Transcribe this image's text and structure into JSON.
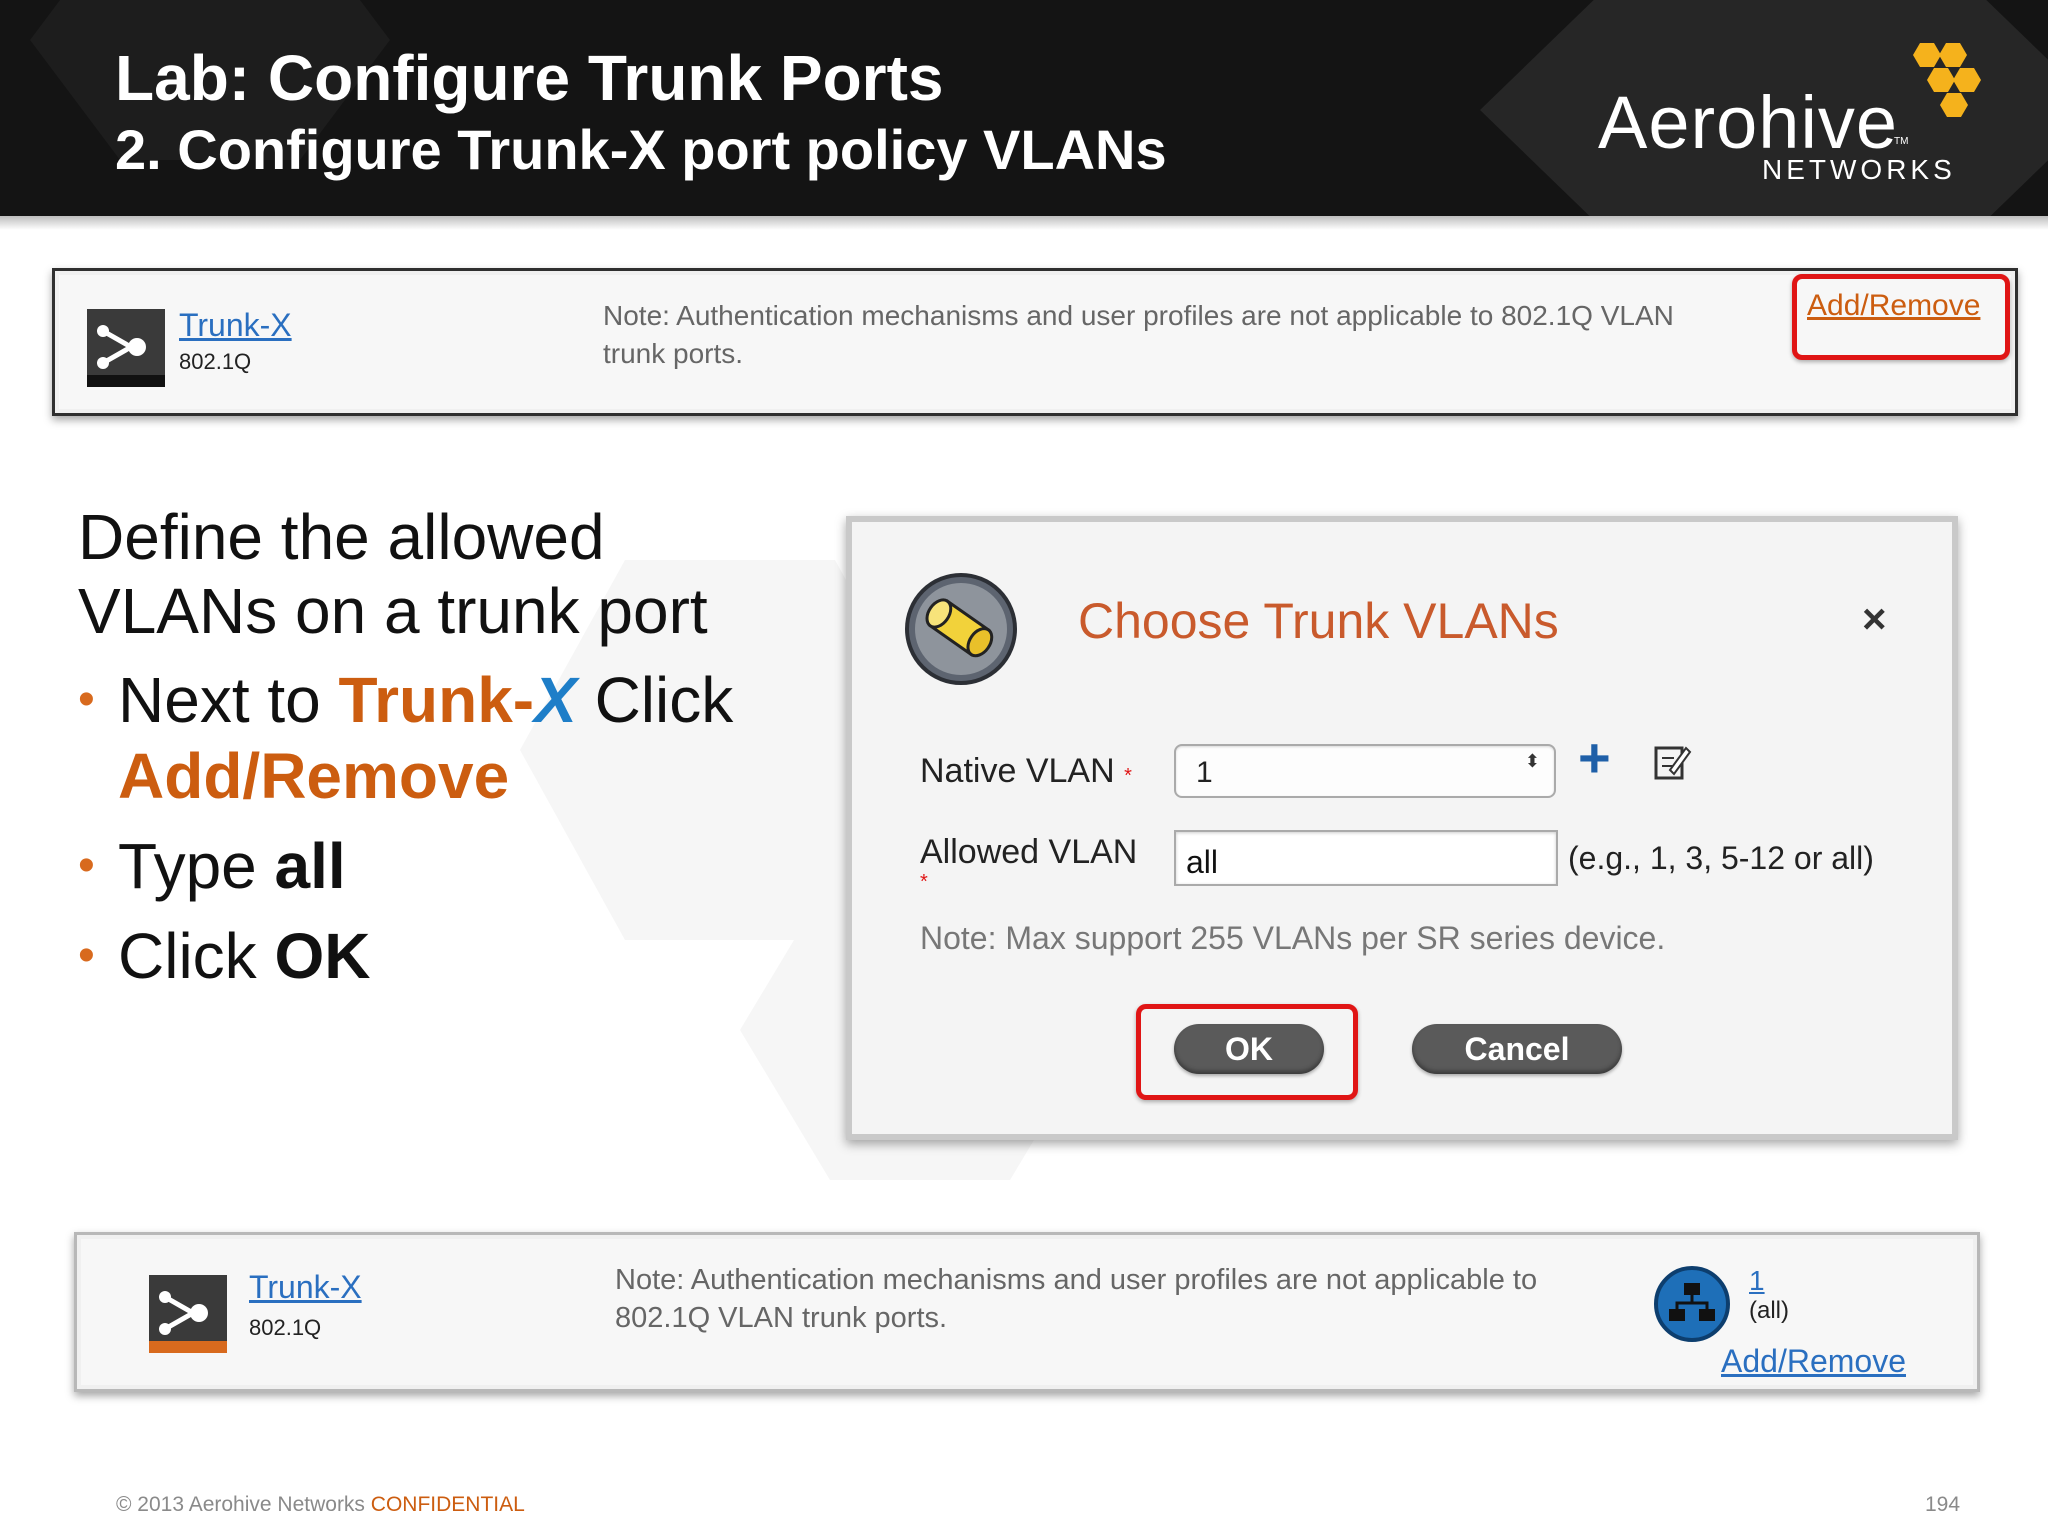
{
  "header": {
    "title": "Lab: Configure Trunk Ports",
    "subtitle": "2. Configure Trunk-X port policy VLANs",
    "logo_word": "Aerohive",
    "logo_tm": "TM",
    "logo_sub": "NETWORKS"
  },
  "top_panel": {
    "port_name": "Trunk-X",
    "port_type": "802.1Q",
    "note_line1": "Note: Authentication mechanisms and user profiles are not applicable to 802.1Q VLAN",
    "note_line2": "trunk ports.",
    "add_remove_label": "Add/Remove"
  },
  "instructions": {
    "heading_line1": "Define the allowed",
    "heading_line2": "VLANs on a trunk port",
    "bullet_dot": "•",
    "b1_pre": "Next to ",
    "b1_trunk": "Trunk-",
    "b1_x": "X",
    "b1_click": " Click",
    "b1_addremove": "Add/Remove",
    "b2_pre": "Type ",
    "b2_bold": "all",
    "b3_pre": "Click ",
    "b3_bold": "OK"
  },
  "dialog": {
    "title": "Choose Trunk VLANs",
    "close_glyph": "×",
    "native_vlan_label": "Native VLAN",
    "native_vlan_value": "1",
    "required_mark": "*",
    "allowed_vlan_label": "Allowed VLAN",
    "allowed_vlan_value": "all",
    "allowed_hint": "(e.g., 1, 3, 5-12 or all)",
    "note": "Note: Max support 255 VLANs per SR series device.",
    "ok_label": "OK",
    "cancel_label": "Cancel",
    "add_glyph": "+",
    "select_arrows": "⬍"
  },
  "bottom_panel": {
    "port_name": "Trunk-X",
    "port_type": "802.1Q",
    "note_line1": "Note: Authentication mechanisms and user profiles are not applicable to",
    "note_line2": "802.1Q VLAN trunk ports.",
    "vlan_link": "1",
    "vlan_sub": "(all)",
    "add_remove_label": "Add/Remove"
  },
  "footer": {
    "copyright": "© 2013 Aerohive Networks ",
    "confidential": "CONFIDENTIAL",
    "page_number": "194"
  },
  "colors": {
    "accent_orange": "#cc5d10",
    "accent_blue": "#1e7ec8",
    "highlight_red": "#e01515",
    "link_blue": "#2a6fc0",
    "dialog_title": "#c95a2c",
    "logo_yellow": "#f5b21c"
  }
}
